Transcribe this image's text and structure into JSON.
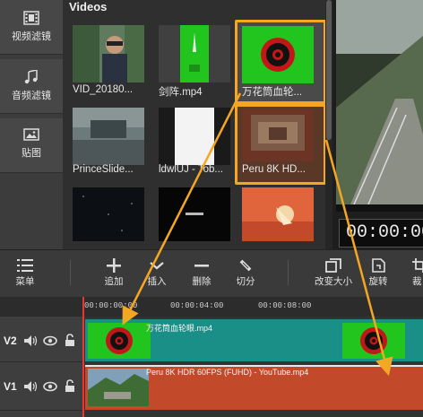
{
  "sidebar": {
    "items": [
      {
        "label": "视频滤镜",
        "icon": "film-icon"
      },
      {
        "label": "音频滤镜",
        "icon": "music-note-icon"
      },
      {
        "label": "贴图",
        "icon": "image-icon"
      }
    ]
  },
  "media": {
    "title": "Videos",
    "items": [
      {
        "label": "VID_20180...",
        "selected": false
      },
      {
        "label": "剑阵.mp4",
        "selected": false
      },
      {
        "label": "万花筒血轮...",
        "selected": true
      },
      {
        "label": "PrinceSlide...",
        "selected": false
      },
      {
        "label": "ldwlUJ - Tob...",
        "selected": false
      },
      {
        "label": "Peru 8K HD...",
        "selected": true
      },
      {
        "label": "",
        "selected": false
      },
      {
        "label": "",
        "selected": false
      },
      {
        "label": "",
        "selected": false
      }
    ]
  },
  "preview": {
    "timecode": "00:00:00"
  },
  "toolbar": {
    "menu": "菜单",
    "add": "追加",
    "insert": "插入",
    "delete": "删除",
    "split": "切分",
    "resize": "改变大小",
    "rotate": "旋转",
    "crop": "裁"
  },
  "timeline": {
    "ruler_ticks": [
      "00:00:00:00",
      "00:00:04:00",
      "00:00:08:00"
    ],
    "tracks": [
      {
        "name": "V2",
        "clip": "万花筒血轮眼.mp4"
      },
      {
        "name": "V1",
        "clip": "Peru 8K HDR 60FPS (FUHD) - YouTube.mp4"
      }
    ]
  },
  "colors": {
    "highlight": "#f5a623",
    "v2_clip": "#1a8f88",
    "v1_clip": "#c24a2a",
    "playhead": "#e33333"
  }
}
